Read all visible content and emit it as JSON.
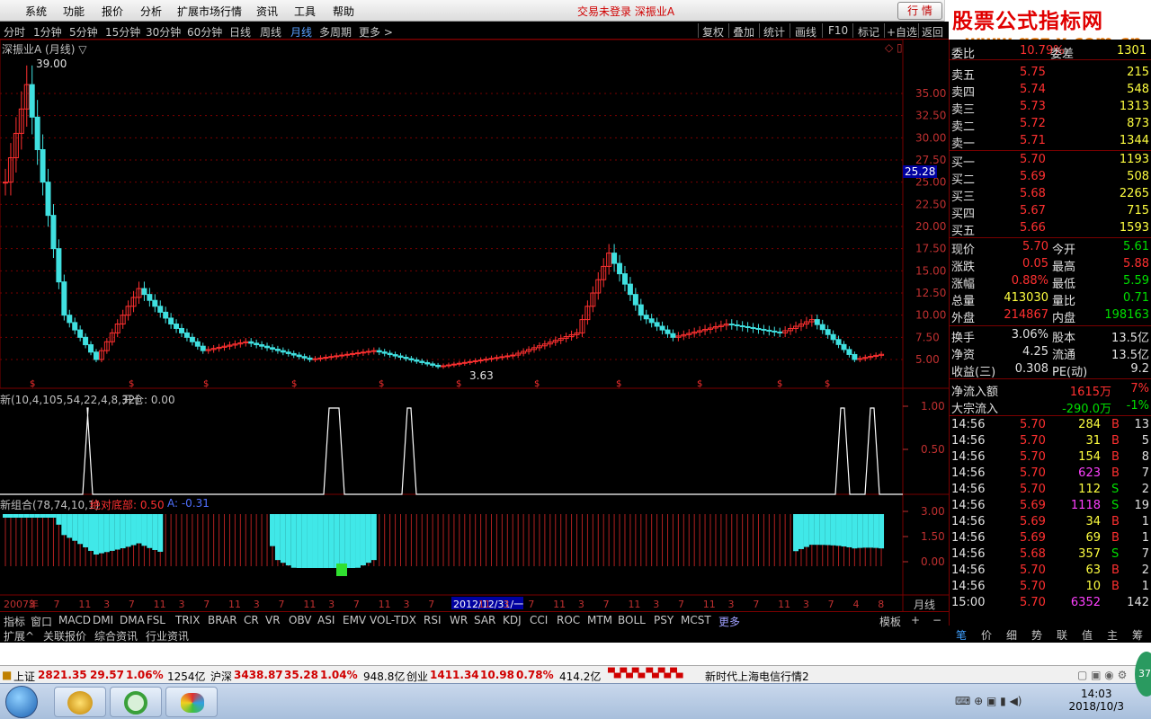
{
  "menubar": {
    "items": [
      "系统",
      "功能",
      "报价",
      "分析",
      "扩展市场行情",
      "资讯",
      "工具",
      "帮助"
    ],
    "center_text": "交易未登录  深振业A",
    "quote_button": "行 情"
  },
  "logo": {
    "title": "股票公式指标网",
    "url": "www.gsz x.com.cn"
  },
  "periods": {
    "items": [
      "分时",
      "1分钟",
      "5分钟",
      "15分钟",
      "30分钟",
      "60分钟",
      "日线",
      "周线",
      "月线",
      "多周期",
      "更多 >"
    ],
    "active": "月线"
  },
  "toolbar_right": [
    "复权",
    "叠加",
    "统计",
    "画线",
    "F10",
    "标记",
    "+自选",
    "返回"
  ],
  "chart": {
    "stock_title": "深振业A (月线) ▽",
    "high_label": "39.00",
    "low_label": "3.63",
    "current_price_tag": "25.28",
    "y_ticks": [
      "35.00",
      "32.50",
      "30.00",
      "27.50",
      "25.00",
      "22.50",
      "20.00",
      "17.50",
      "15.00",
      "12.50",
      "10.00",
      "7.50",
      "5.00"
    ],
    "ind1_title": "新(10,4,105,54,22,4,8,32)",
    "ind1_extra": "开仓: 0.00",
    "ind1_ticks": [
      "1.00",
      "0.50"
    ],
    "ind2_title": "新组合(78,74,10,1)",
    "ind2_red": "绝对底部: 0.50",
    "ind2_blue": "A: -0.31",
    "ind2_ticks": [
      "3.00",
      "1.50",
      "0.00"
    ],
    "x_axis": [
      "2007年",
      "3",
      "7",
      "11",
      "3",
      "7",
      "11",
      "3",
      "7",
      "11",
      "3",
      "7",
      "11",
      "3",
      "7",
      "11",
      "3",
      "7",
      "2012/12/31/一",
      "11",
      "3",
      "7",
      "11",
      "3",
      "7",
      "11",
      "3",
      "7",
      "11",
      "3",
      "7",
      "11",
      "3",
      "7",
      "4",
      "8"
    ],
    "x_axis_period": "月线"
  },
  "indicators": [
    "指标",
    "窗口",
    "MACD",
    "DMI",
    "DMA",
    "FSL",
    "TRIX",
    "BRAR",
    "CR",
    "VR",
    "OBV",
    "ASI",
    "EMV",
    "VOL-TDX",
    "RSI",
    "WR",
    "SAR",
    "KDJ",
    "CCI",
    "ROC",
    "MTM",
    "BOLL",
    "PSY",
    "MCST",
    "更多"
  ],
  "indicator_right": [
    "模板",
    "+",
    "−"
  ],
  "subtabs": [
    "扩展^",
    "关联报价",
    "综合资讯",
    "行业资讯"
  ],
  "right_panel": {
    "top_partial": [
      "委比",
      "10.79%",
      "委差",
      "1301"
    ],
    "asks": [
      {
        "label": "卖五",
        "price": "5.75",
        "vol": "215"
      },
      {
        "label": "卖四",
        "price": "5.74",
        "vol": "548"
      },
      {
        "label": "卖三",
        "price": "5.73",
        "vol": "1313"
      },
      {
        "label": "卖二",
        "price": "5.72",
        "vol": "873"
      },
      {
        "label": "卖一",
        "price": "5.71",
        "vol": "1344"
      }
    ],
    "bids": [
      {
        "label": "买一",
        "price": "5.70",
        "vol": "1193"
      },
      {
        "label": "买二",
        "price": "5.69",
        "vol": "508"
      },
      {
        "label": "买三",
        "price": "5.68",
        "vol": "2265"
      },
      {
        "label": "买四",
        "price": "5.67",
        "vol": "715"
      },
      {
        "label": "买五",
        "price": "5.66",
        "vol": "1593"
      }
    ],
    "stats": [
      {
        "l1": "现价",
        "v1": "5.70",
        "c1": "red",
        "l2": "今开",
        "v2": "5.61",
        "c2": "green"
      },
      {
        "l1": "涨跌",
        "v1": "0.05",
        "c1": "red",
        "l2": "最高",
        "v2": "5.88",
        "c2": "red"
      },
      {
        "l1": "涨幅",
        "v1": "0.88%",
        "c1": "red",
        "l2": "最低",
        "v2": "5.59",
        "c2": "green"
      },
      {
        "l1": "总量",
        "v1": "413030",
        "c1": "yellow",
        "l2": "量比",
        "v2": "0.71",
        "c2": "green"
      },
      {
        "l1": "外盘",
        "v1": "214867",
        "c1": "red",
        "l2": "内盘",
        "v2": "198163",
        "c2": "green"
      }
    ],
    "stats2": [
      {
        "l1": "换手",
        "v1": "3.06%",
        "l2": "股本",
        "v2": "13.5亿"
      },
      {
        "l1": "净资",
        "v1": "4.25",
        "l2": "流通",
        "v2": "13.5亿"
      },
      {
        "l1": "收益(三)",
        "v1": "0.308",
        "l2": "PE(动)",
        "v2": "9.2"
      }
    ],
    "flows": [
      {
        "label": "净流入额",
        "value": "1615万",
        "pct": "7%",
        "color": "red"
      },
      {
        "label": "大宗流入",
        "value": "-290.0万",
        "pct": "-1%",
        "color": "green"
      }
    ],
    "ticks": [
      {
        "t": "14:56",
        "p": "5.70",
        "pc": "red",
        "v": "284",
        "vc": "yellow",
        "s": "B",
        "n": "13"
      },
      {
        "t": "14:56",
        "p": "5.70",
        "pc": "red",
        "v": "31",
        "vc": "yellow",
        "s": "B",
        "n": "5"
      },
      {
        "t": "14:56",
        "p": "5.70",
        "pc": "red",
        "v": "154",
        "vc": "yellow",
        "s": "B",
        "n": "8"
      },
      {
        "t": "14:56",
        "p": "5.70",
        "pc": "red",
        "v": "623",
        "vc": "magenta",
        "s": "B",
        "n": "7"
      },
      {
        "t": "14:56",
        "p": "5.70",
        "pc": "red",
        "v": "112",
        "vc": "yellow",
        "s": "S",
        "n": "2"
      },
      {
        "t": "14:56",
        "p": "5.69",
        "pc": "red",
        "v": "1118",
        "vc": "magenta",
        "s": "S",
        "n": "19"
      },
      {
        "t": "14:56",
        "p": "5.69",
        "pc": "red",
        "v": "34",
        "vc": "yellow",
        "s": "B",
        "n": "1"
      },
      {
        "t": "14:56",
        "p": "5.69",
        "pc": "red",
        "v": "69",
        "vc": "yellow",
        "s": "B",
        "n": "1"
      },
      {
        "t": "14:56",
        "p": "5.68",
        "pc": "red",
        "v": "357",
        "vc": "yellow",
        "s": "S",
        "n": "7"
      },
      {
        "t": "14:56",
        "p": "5.70",
        "pc": "red",
        "v": "63",
        "vc": "yellow",
        "s": "B",
        "n": "2"
      },
      {
        "t": "14:56",
        "p": "5.70",
        "pc": "red",
        "v": "10",
        "vc": "yellow",
        "s": "B",
        "n": "1"
      },
      {
        "t": "15:00",
        "p": "5.70",
        "pc": "red",
        "v": "6352",
        "vc": "magenta",
        "s": "",
        "n": "142"
      }
    ],
    "bottom_tabs": [
      "笔",
      "价",
      "细",
      "势",
      "联",
      "值",
      "主",
      "筹"
    ]
  },
  "statusbar": {
    "sh_label": "上证",
    "sh_value": "2821.35",
    "sh_chg": "29.57",
    "sh_pct": "1.06%",
    "sh_amt": "1254亿",
    "sz_label": "沪深",
    "sz_value": "3438.87",
    "sz_chg": "35.28",
    "sz_pct": "1.04%",
    "sz_amt": "948.8亿",
    "cy_label": "创业",
    "cy_value": "1411.34",
    "cy_chg": "10.98",
    "cy_pct": "0.78%",
    "cy_amt": "414.2亿",
    "server": "新时代上海电信行情2"
  },
  "taskbar": {
    "time": "14:03",
    "date": "2018/10/3",
    "badge": "37"
  },
  "colors": {
    "up": "#ff3030",
    "down": "#40e0e0",
    "bg": "#000000",
    "grid": "#7a0000"
  }
}
